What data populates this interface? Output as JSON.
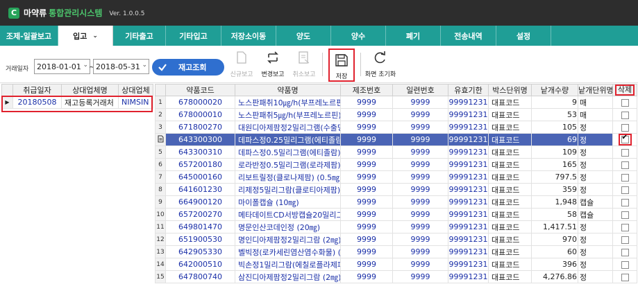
{
  "app": {
    "logo_letter": "C",
    "name1": "마약류",
    "name2": "통합관리시스템",
    "version": "Ver. 1.0.0.5"
  },
  "menu": [
    {
      "label": "조제-일괄보고",
      "active": false
    },
    {
      "label": "입고",
      "active": true
    },
    {
      "label": "기타출고",
      "active": false
    },
    {
      "label": "기타입고",
      "active": false
    },
    {
      "label": "저장소이동",
      "active": false
    },
    {
      "label": "양도",
      "active": false
    },
    {
      "label": "양수",
      "active": false
    },
    {
      "label": "폐기",
      "active": false
    },
    {
      "label": "전송내역",
      "active": false
    },
    {
      "label": "설정",
      "active": false
    }
  ],
  "toolbar": {
    "date_label": "거래일자",
    "date_from": "2018-01-01",
    "date_to": "2018-05-31",
    "tilde": "~",
    "search_label": "재고조회",
    "new_report": "신규보고",
    "change_report": "변경보고",
    "cancel_report": "취소보고",
    "save": "저장",
    "reset": "화면 초기화"
  },
  "left_grid": {
    "columns": [
      "취급일자",
      "상대업체명",
      "상대업체"
    ],
    "rows": [
      {
        "date": "20180508",
        "company": "재고등록거래처",
        "code": "NIMSIN"
      }
    ]
  },
  "right_grid": {
    "columns": [
      "약품코드",
      "약품명",
      "제조번호",
      "일련번호",
      "유효기한",
      "박스단위명",
      "낱개수량",
      "낱개단위명",
      "삭제"
    ],
    "rows": [
      {
        "no": "1",
        "code": "678000020",
        "name": "노스판패취10㎍/h(부프레노르핀",
        "lot": "9999",
        "serial": "9999",
        "exp": "99991231",
        "box": "대표코드",
        "qty": "9",
        "unit": "매",
        "checked": false
      },
      {
        "no": "2",
        "code": "678000010",
        "name": "노스판패취5㎍/h(부프레노르핀)",
        "lot": "9999",
        "serial": "9999",
        "exp": "99991231",
        "box": "대표코드",
        "qty": "53",
        "unit": "매",
        "checked": false
      },
      {
        "no": "3",
        "code": "671800270",
        "name": "대원디아제팜정2밀리그램(수출명",
        "lot": "9999",
        "serial": "9999",
        "exp": "99991231",
        "box": "대표코드",
        "qty": "105",
        "unit": "정",
        "checked": false
      },
      {
        "no": "4",
        "code": "643300300",
        "name": "데파스정0.25밀리그램(에티졸람)",
        "lot": "9999",
        "serial": "9999",
        "exp": "99991231",
        "box": "대표코드",
        "qty": "69",
        "unit": "정",
        "checked": true
      },
      {
        "no": "5",
        "code": "643300310",
        "name": "데파스정0.5밀리그램(에티졸람)",
        "lot": "9999",
        "serial": "9999",
        "exp": "99991231",
        "box": "대표코드",
        "qty": "109",
        "unit": "정",
        "checked": false
      },
      {
        "no": "6",
        "code": "657200180",
        "name": "로라반정0.5밀리그램(로라제팜)",
        "lot": "9999",
        "serial": "9999",
        "exp": "99991231",
        "box": "대표코드",
        "qty": "165",
        "unit": "정",
        "checked": false
      },
      {
        "no": "7",
        "code": "645000160",
        "name": "리보트릴정(클로나제팜) (0.5㎎)",
        "lot": "9999",
        "serial": "9999",
        "exp": "99991231",
        "box": "대표코드",
        "qty": "797.5",
        "unit": "정",
        "checked": false
      },
      {
        "no": "8",
        "code": "641601230",
        "name": "리제정5밀리그람(클로티아제팜)",
        "lot": "9999",
        "serial": "9999",
        "exp": "99991231",
        "box": "대표코드",
        "qty": "359",
        "unit": "정",
        "checked": false
      },
      {
        "no": "9",
        "code": "664900120",
        "name": "마이폴캡슐 (10㎎)",
        "lot": "9999",
        "serial": "9999",
        "exp": "99991231",
        "box": "대표코드",
        "qty": "1,948",
        "unit": "캡슐",
        "checked": false
      },
      {
        "no": "10",
        "code": "657200270",
        "name": "메타데이트CD서방캡슐20밀리그",
        "lot": "9999",
        "serial": "9999",
        "exp": "99991231",
        "box": "대표코드",
        "qty": "58",
        "unit": "캡슐",
        "checked": false
      },
      {
        "no": "11",
        "code": "649801470",
        "name": "명문인산코데인정 (20㎎)",
        "lot": "9999",
        "serial": "9999",
        "exp": "99991231",
        "box": "대표코드",
        "qty": "1,417.51",
        "unit": "정",
        "checked": false
      },
      {
        "no": "12",
        "code": "651900530",
        "name": "명인디아제팜정2밀리그람 (2㎎)",
        "lot": "9999",
        "serial": "9999",
        "exp": "99991231",
        "box": "대표코드",
        "qty": "970",
        "unit": "정",
        "checked": false
      },
      {
        "no": "13",
        "code": "642905330",
        "name": "벨빅정(로카세린염산염수화물) (",
        "lot": "9999",
        "serial": "9999",
        "exp": "99991231",
        "box": "대표코드",
        "qty": "60",
        "unit": "정",
        "checked": false
      },
      {
        "no": "14",
        "code": "642000510",
        "name": "빅손정1밀리그람(에칠로플라제피",
        "lot": "9999",
        "serial": "9999",
        "exp": "99991231",
        "box": "대표코드",
        "qty": "396",
        "unit": "정",
        "checked": false
      },
      {
        "no": "15",
        "code": "647800740",
        "name": "삼진디아제팜정2밀리그람 (2㎎)",
        "lot": "9999",
        "serial": "9999",
        "exp": "99991231",
        "box": "대표코드",
        "qty": "4,276.86",
        "unit": "정",
        "checked": false
      }
    ]
  }
}
